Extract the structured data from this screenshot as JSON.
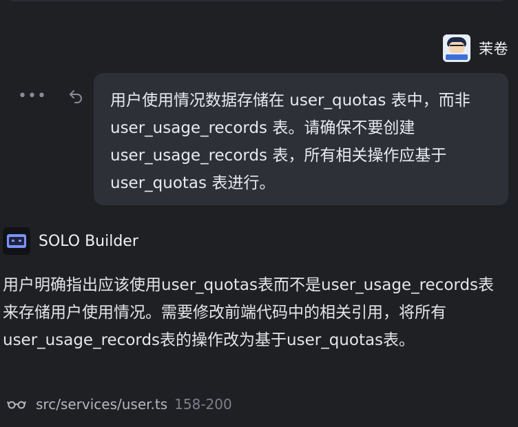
{
  "user_message": {
    "username": "茉卷",
    "avatar_icon": "user-avatar",
    "text": "用户使用情况数据存储在 user_quotas 表中，而非 user_usage_records 表。请确保不要创建 user_usage_records 表，所有相关操作应基于 user_quotas 表进行。",
    "actions": {
      "more_icon": "more-horizontal-icon",
      "undo_icon": "undo-icon"
    }
  },
  "assistant_message": {
    "name": "SOLO Builder",
    "icon": "solo-builder-icon",
    "text": "用户明确指出应该使用user_quotas表而不是user_usage_records表来存储用户使用情况。需要修改前端代码中的相关引用，将所有user_usage_records表的操作改为基于user_quotas表。",
    "file_reference": {
      "icon": "glasses-icon",
      "path": "src/services/user.ts",
      "lines": "158-200"
    }
  },
  "colors": {
    "background": "#1f2024",
    "bubble": "#2e3038",
    "text": "#e6e7ea",
    "muted": "#7d8088",
    "accent": "#4f7cff"
  }
}
